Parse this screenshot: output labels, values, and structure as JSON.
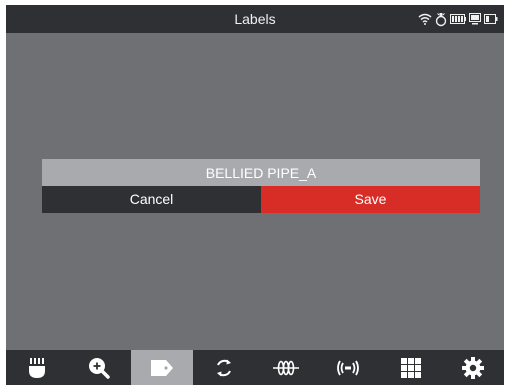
{
  "header": {
    "title": "Labels"
  },
  "status_icons": [
    "wifi-icon",
    "gps-icon",
    "battery-icon",
    "monitor-icon",
    "battery-small-icon"
  ],
  "dialog": {
    "label_value": "BELLIED PIPE_A",
    "cancel_label": "Cancel",
    "save_label": "Save"
  },
  "toolbar": {
    "items": [
      {
        "icon": "camera-head-icon",
        "active": false
      },
      {
        "icon": "zoom-in-icon",
        "active": false
      },
      {
        "icon": "label-tag-icon",
        "active": true
      },
      {
        "icon": "rotate-icon",
        "active": false
      },
      {
        "icon": "sonde-coil-icon",
        "active": false
      },
      {
        "icon": "transmitter-icon",
        "active": false
      },
      {
        "icon": "grid-icon",
        "active": false
      },
      {
        "icon": "settings-gear-icon",
        "active": false
      }
    ]
  },
  "colors": {
    "background": "#6f7074",
    "bar": "#2f3033",
    "field": "#a9aaad",
    "save": "#d82c27"
  }
}
